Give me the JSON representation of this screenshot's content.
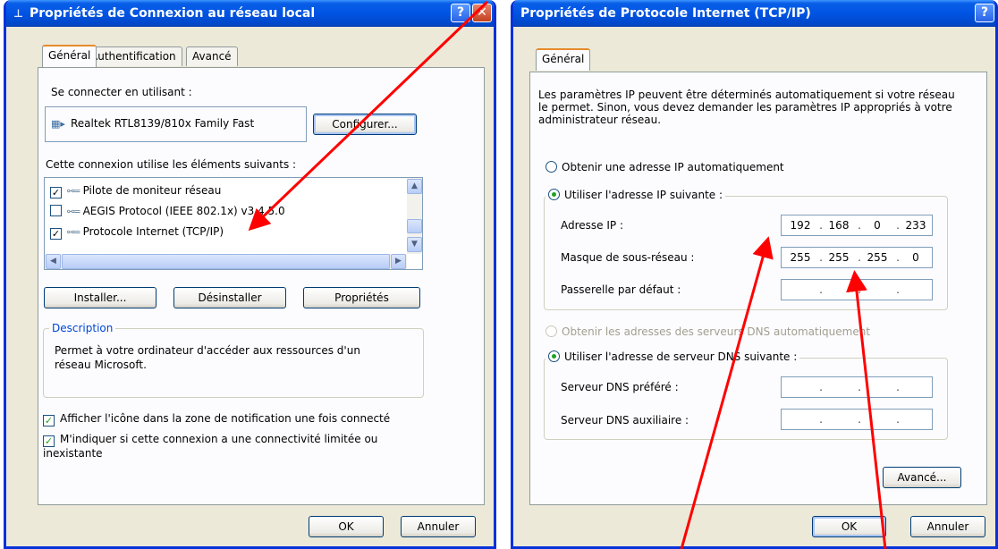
{
  "left_dialog": {
    "title": "Propriétés de Connexion au réseau local",
    "tabs": [
      "Général",
      "Authentification",
      "Avancé"
    ],
    "connect_using_label": "Se connecter en utilisant :",
    "adapter_name": "Realtek RTL8139/810x Family Fast",
    "configure_button": "Configurer...",
    "items_label": "Cette connexion utilise les éléments suivants :",
    "components": [
      {
        "label": "Pilote de moniteur réseau",
        "checked": true
      },
      {
        "label": "AEGIS Protocol (IEEE 802.1x) v3.4.5.0",
        "checked": false
      },
      {
        "label": "Protocole Internet (TCP/IP)",
        "checked": true
      }
    ],
    "install_button": "Installer...",
    "uninstall_button": "Désinstaller",
    "properties_button": "Propriétés",
    "description_title": "Description",
    "description_text": "Permet à votre ordinateur d'accéder aux ressources d'un réseau Microsoft.",
    "notify_icon_label": "Afficher l'icône dans la zone de notification une fois connecté",
    "notify_limited_label": "M'indiquer si cette connexion a une connectivité limitée ou inexistante",
    "ok_button": "OK",
    "cancel_button": "Annuler"
  },
  "right_dialog": {
    "title": "Propriétés de Protocole Internet (TCP/IP)",
    "tabs": [
      "Général"
    ],
    "intro_text": "Les paramètres IP peuvent être déterminés automatiquement si votre réseau le permet. Sinon, vous devez demander les paramètres IP appropriés à votre administrateur réseau.",
    "auto_ip_label": "Obtenir une adresse IP automatiquement",
    "manual_ip_label": "Utiliser l'adresse IP suivante :",
    "ip_address_label": "Adresse IP :",
    "ip_address": [
      "192",
      "168",
      "0",
      "233"
    ],
    "subnet_label": "Masque de sous-réseau :",
    "subnet_mask": [
      "255",
      "255",
      "255",
      "0"
    ],
    "gateway_label": "Passerelle par défaut :",
    "auto_dns_label": "Obtenir les adresses des serveurs DNS automatiquement",
    "manual_dns_label": "Utiliser l'adresse de serveur DNS suivante :",
    "preferred_dns_label": "Serveur DNS préféré :",
    "alternate_dns_label": "Serveur DNS auxiliaire :",
    "advanced_button": "Avancé...",
    "ok_button": "OK",
    "cancel_button": "Annuler"
  },
  "annotation_color": "#ff0000"
}
